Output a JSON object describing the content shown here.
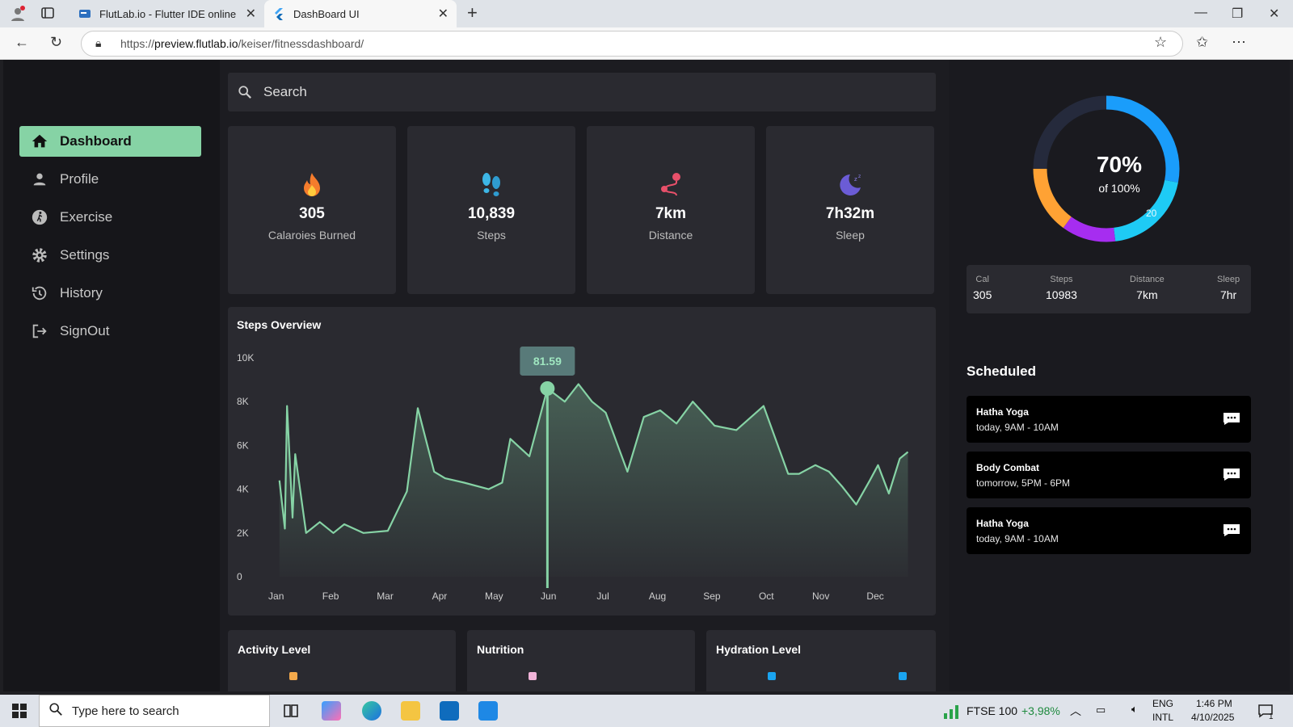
{
  "browser": {
    "tabs": [
      {
        "title": "FlutLab.io - Flutter IDE online",
        "active": false
      },
      {
        "title": "DashBoard UI",
        "active": true
      }
    ],
    "url_prefix": "https://",
    "url_host": "preview.flutlab.io",
    "url_path": "/keiser/fitnessdashboard/"
  },
  "sidebar": {
    "items": [
      {
        "label": "Dashboard",
        "icon": "home-icon",
        "active": true
      },
      {
        "label": "Profile",
        "icon": "person-icon"
      },
      {
        "label": "Exercise",
        "icon": "run-icon"
      },
      {
        "label": "Settings",
        "icon": "gear-icon"
      },
      {
        "label": "History",
        "icon": "history-icon"
      },
      {
        "label": "SignOut",
        "icon": "logout-icon"
      }
    ]
  },
  "search": {
    "placeholder": "Search"
  },
  "stats": [
    {
      "value": "305",
      "label": "Calaroies Burned",
      "icon": "fire-icon",
      "color": "#f57c2c"
    },
    {
      "value": "10,839",
      "label": "Steps",
      "icon": "footsteps-icon",
      "color": "#3db6e6"
    },
    {
      "value": "7km",
      "label": "Distance",
      "icon": "route-icon",
      "color": "#e8506a"
    },
    {
      "value": "7h32m",
      "label": "Sleep",
      "icon": "moon-icon",
      "color": "#6b5cd6"
    }
  ],
  "chart_data": {
    "type": "area",
    "title": "Steps Overview",
    "categories": [
      "Jan",
      "Feb",
      "Mar",
      "Apr",
      "May",
      "Jun",
      "Jul",
      "Aug",
      "Sep",
      "Oct",
      "Nov",
      "Dec"
    ],
    "ytick_labels": [
      "0",
      "2K",
      "4K",
      "6K",
      "8K",
      "10K"
    ],
    "ylim": [
      0,
      10000
    ],
    "color": "#86d3a5",
    "tooltip": "81.59",
    "x": [
      0.06,
      0.16,
      0.2,
      0.3,
      0.35,
      0.55,
      0.8,
      1.05,
      1.25,
      1.6,
      2.05,
      2.4,
      2.6,
      2.9,
      3.1,
      3.45,
      3.9,
      4.15,
      4.3,
      4.65,
      4.98,
      5.3,
      5.55,
      5.8,
      6.05,
      6.45,
      6.75,
      7.05,
      7.35,
      7.65,
      8.05,
      8.45,
      8.95,
      9.4,
      9.6,
      9.9,
      10.15,
      10.4,
      10.65,
      10.9,
      11.05,
      11.25,
      11.45,
      11.6
    ],
    "y": [
      4400,
      2200,
      7800,
      2700,
      5600,
      2000,
      2500,
      2000,
      2400,
      2000,
      2100,
      3900,
      7700,
      4800,
      4500,
      4300,
      4000,
      4300,
      6300,
      5500,
      8600,
      8000,
      8800,
      8000,
      7500,
      4800,
      7300,
      7600,
      7000,
      8000,
      6900,
      6700,
      7800,
      4700,
      4700,
      5100,
      4800,
      4100,
      3300,
      4400,
      5100,
      3800,
      5400,
      5700
    ],
    "marker_index": 20,
    "ylabel": "",
    "xlabel": ""
  },
  "mini_cards": [
    {
      "title": "Activity Level",
      "dot_color": "#f4a94b"
    },
    {
      "title": "Nutrition",
      "dot_color": "#f0b3d8"
    },
    {
      "title": "Hydration Level",
      "dot_color": "#1aa4f0"
    }
  ],
  "ring": {
    "percent": "70%",
    "sub": "of 100%",
    "segment_label": "20",
    "segments": [
      {
        "fraction": 0.28,
        "color": "#1a9dfb"
      },
      {
        "fraction": 0.2,
        "color": "#1ecbf5"
      },
      {
        "fraction": 0.12,
        "color": "#a62df0"
      },
      {
        "fraction": 0.15,
        "color": "#ffa234"
      },
      {
        "fraction": 0.25,
        "color": "#252a3c"
      }
    ]
  },
  "summary": [
    {
      "key": "Cal",
      "value": "305"
    },
    {
      "key": "Steps",
      "value": "10983"
    },
    {
      "key": "Distance",
      "value": "7km"
    },
    {
      "key": "Sleep",
      "value": "7hr"
    }
  ],
  "scheduled": {
    "title": "Scheduled",
    "events": [
      {
        "name": "Hatha Yoga",
        "time": "today, 9AM - 10AM"
      },
      {
        "name": "Body Combat",
        "time": "tomorrow, 5PM - 6PM"
      },
      {
        "name": "Hatha Yoga",
        "time": "today, 9AM - 10AM"
      }
    ]
  },
  "taskbar": {
    "search_placeholder": "Type here to search",
    "stock_name": "FTSE 100",
    "stock_change": "+3,98%",
    "lang1": "ENG",
    "lang2": "INTL",
    "time": "1:46 PM",
    "date": "4/10/2025",
    "notification_count": "1"
  }
}
